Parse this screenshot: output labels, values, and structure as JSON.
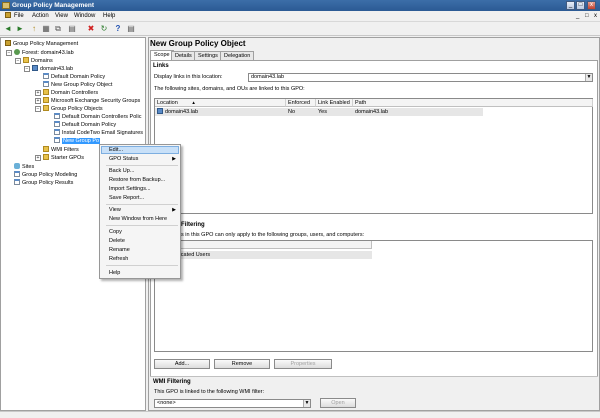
{
  "window": {
    "title": "Group Policy Management",
    "min": "_",
    "max": "□",
    "close": "x"
  },
  "menu": [
    "File",
    "Action",
    "View",
    "Window",
    "Help"
  ],
  "menu_right": {
    "min": "_",
    "max": "□",
    "close": "x"
  },
  "toolbar": {
    "back": "◄",
    "forward": "►",
    "up": "↑",
    "properties": "▦",
    "copy": "⧉",
    "delete": "✖",
    "refresh": "↻",
    "help": "?",
    "mmc": "▤"
  },
  "tree": {
    "root": "Group Policy Management",
    "forest": "Forest: domain43.lab",
    "domains": "Domains",
    "domain": "domain43.lab",
    "items": [
      "Default Domain Policy",
      "New Group Policy Object",
      "Domain Controllers",
      "Microsoft Exchange Security Groups",
      "Group Policy Objects"
    ],
    "gpo_children": [
      "Default Domain Controllers Polic",
      "Default Domain Policy",
      "Instal CodeTwo Email Signatures"
    ],
    "selected": "New Group Po",
    "wmi": "WMI Filters",
    "starter": "Starter GPOs",
    "sites": "Sites",
    "modeling": "Group Policy Modeling",
    "results": "Group Policy Results",
    "expand_plus": "+",
    "expand_minus": "−"
  },
  "panel": {
    "title": "New Group Policy Object",
    "tabs": [
      "Scope",
      "Details",
      "Settings",
      "Delegation"
    ]
  },
  "links": {
    "heading": "Links",
    "display_label": "Display links in this location:",
    "location_value": "domain43.lab",
    "dropdown_arrow": "▼",
    "desc": "The following sites, domains, and OUs are linked to this GPO:",
    "columns": [
      "Location",
      "Enforced",
      "Link Enabled",
      "Path"
    ],
    "sort_arrow": "▲",
    "rows": [
      {
        "location": "domain43.lab",
        "enforced": "No",
        "enabled": "Yes",
        "path": "domain43.lab"
      }
    ]
  },
  "security": {
    "heading": "Filtering",
    "desc": "s in this GPO can only apply to the following groups, users, and computers:",
    "rows": [
      "nticated Users"
    ],
    "buttons": {
      "add": "Add...",
      "remove": "Remove",
      "properties": "Properties"
    }
  },
  "wmi": {
    "heading": "WMI Filtering",
    "desc": "This GPO is linked to the following WMI filter:",
    "value": "<none>",
    "open": "Open"
  },
  "context_menu": {
    "items": [
      "Edit...",
      "GPO Status",
      "Back Up...",
      "Restore from Backup...",
      "Import Settings...",
      "Save Report...",
      "View",
      "New Window from Here",
      "Copy",
      "Delete",
      "Rename",
      "Refresh",
      "Help"
    ],
    "submenu_arrow": "▶"
  }
}
